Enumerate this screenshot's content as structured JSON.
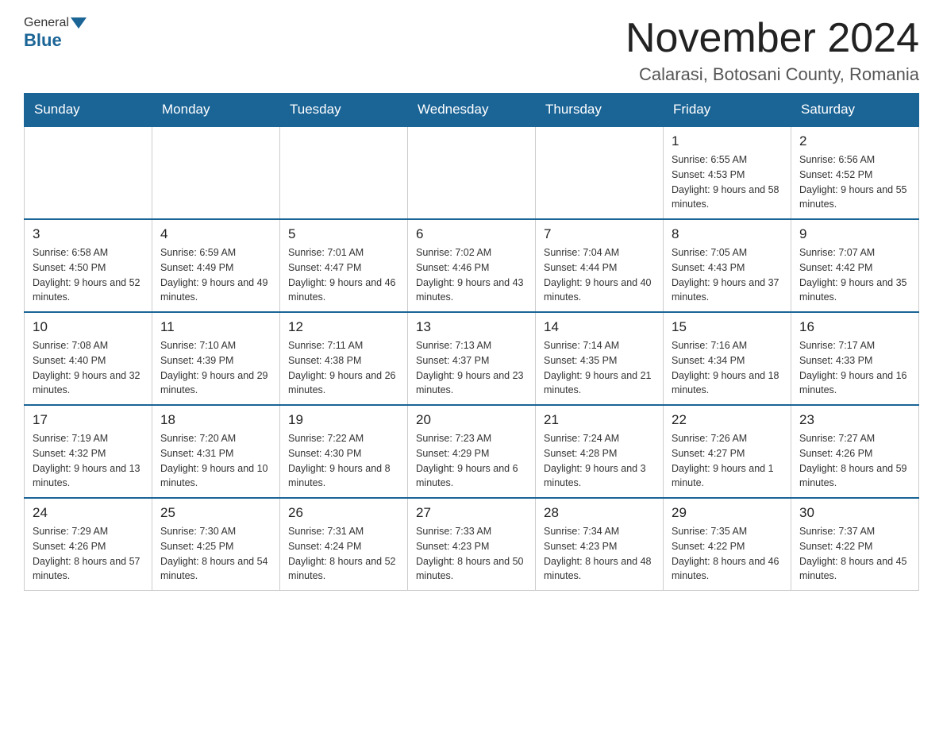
{
  "header": {
    "logo_general": "General",
    "logo_blue": "Blue",
    "title": "November 2024",
    "subtitle": "Calarasi, Botosani County, Romania"
  },
  "weekdays": [
    "Sunday",
    "Monday",
    "Tuesday",
    "Wednesday",
    "Thursday",
    "Friday",
    "Saturday"
  ],
  "weeks": [
    [
      {
        "day": "",
        "info": ""
      },
      {
        "day": "",
        "info": ""
      },
      {
        "day": "",
        "info": ""
      },
      {
        "day": "",
        "info": ""
      },
      {
        "day": "",
        "info": ""
      },
      {
        "day": "1",
        "info": "Sunrise: 6:55 AM\nSunset: 4:53 PM\nDaylight: 9 hours\nand 58 minutes."
      },
      {
        "day": "2",
        "info": "Sunrise: 6:56 AM\nSunset: 4:52 PM\nDaylight: 9 hours\nand 55 minutes."
      }
    ],
    [
      {
        "day": "3",
        "info": "Sunrise: 6:58 AM\nSunset: 4:50 PM\nDaylight: 9 hours\nand 52 minutes."
      },
      {
        "day": "4",
        "info": "Sunrise: 6:59 AM\nSunset: 4:49 PM\nDaylight: 9 hours\nand 49 minutes."
      },
      {
        "day": "5",
        "info": "Sunrise: 7:01 AM\nSunset: 4:47 PM\nDaylight: 9 hours\nand 46 minutes."
      },
      {
        "day": "6",
        "info": "Sunrise: 7:02 AM\nSunset: 4:46 PM\nDaylight: 9 hours\nand 43 minutes."
      },
      {
        "day": "7",
        "info": "Sunrise: 7:04 AM\nSunset: 4:44 PM\nDaylight: 9 hours\nand 40 minutes."
      },
      {
        "day": "8",
        "info": "Sunrise: 7:05 AM\nSunset: 4:43 PM\nDaylight: 9 hours\nand 37 minutes."
      },
      {
        "day": "9",
        "info": "Sunrise: 7:07 AM\nSunset: 4:42 PM\nDaylight: 9 hours\nand 35 minutes."
      }
    ],
    [
      {
        "day": "10",
        "info": "Sunrise: 7:08 AM\nSunset: 4:40 PM\nDaylight: 9 hours\nand 32 minutes."
      },
      {
        "day": "11",
        "info": "Sunrise: 7:10 AM\nSunset: 4:39 PM\nDaylight: 9 hours\nand 29 minutes."
      },
      {
        "day": "12",
        "info": "Sunrise: 7:11 AM\nSunset: 4:38 PM\nDaylight: 9 hours\nand 26 minutes."
      },
      {
        "day": "13",
        "info": "Sunrise: 7:13 AM\nSunset: 4:37 PM\nDaylight: 9 hours\nand 23 minutes."
      },
      {
        "day": "14",
        "info": "Sunrise: 7:14 AM\nSunset: 4:35 PM\nDaylight: 9 hours\nand 21 minutes."
      },
      {
        "day": "15",
        "info": "Sunrise: 7:16 AM\nSunset: 4:34 PM\nDaylight: 9 hours\nand 18 minutes."
      },
      {
        "day": "16",
        "info": "Sunrise: 7:17 AM\nSunset: 4:33 PM\nDaylight: 9 hours\nand 16 minutes."
      }
    ],
    [
      {
        "day": "17",
        "info": "Sunrise: 7:19 AM\nSunset: 4:32 PM\nDaylight: 9 hours\nand 13 minutes."
      },
      {
        "day": "18",
        "info": "Sunrise: 7:20 AM\nSunset: 4:31 PM\nDaylight: 9 hours\nand 10 minutes."
      },
      {
        "day": "19",
        "info": "Sunrise: 7:22 AM\nSunset: 4:30 PM\nDaylight: 9 hours\nand 8 minutes."
      },
      {
        "day": "20",
        "info": "Sunrise: 7:23 AM\nSunset: 4:29 PM\nDaylight: 9 hours\nand 6 minutes."
      },
      {
        "day": "21",
        "info": "Sunrise: 7:24 AM\nSunset: 4:28 PM\nDaylight: 9 hours\nand 3 minutes."
      },
      {
        "day": "22",
        "info": "Sunrise: 7:26 AM\nSunset: 4:27 PM\nDaylight: 9 hours\nand 1 minute."
      },
      {
        "day": "23",
        "info": "Sunrise: 7:27 AM\nSunset: 4:26 PM\nDaylight: 8 hours\nand 59 minutes."
      }
    ],
    [
      {
        "day": "24",
        "info": "Sunrise: 7:29 AM\nSunset: 4:26 PM\nDaylight: 8 hours\nand 57 minutes."
      },
      {
        "day": "25",
        "info": "Sunrise: 7:30 AM\nSunset: 4:25 PM\nDaylight: 8 hours\nand 54 minutes."
      },
      {
        "day": "26",
        "info": "Sunrise: 7:31 AM\nSunset: 4:24 PM\nDaylight: 8 hours\nand 52 minutes."
      },
      {
        "day": "27",
        "info": "Sunrise: 7:33 AM\nSunset: 4:23 PM\nDaylight: 8 hours\nand 50 minutes."
      },
      {
        "day": "28",
        "info": "Sunrise: 7:34 AM\nSunset: 4:23 PM\nDaylight: 8 hours\nand 48 minutes."
      },
      {
        "day": "29",
        "info": "Sunrise: 7:35 AM\nSunset: 4:22 PM\nDaylight: 8 hours\nand 46 minutes."
      },
      {
        "day": "30",
        "info": "Sunrise: 7:37 AM\nSunset: 4:22 PM\nDaylight: 8 hours\nand 45 minutes."
      }
    ]
  ]
}
